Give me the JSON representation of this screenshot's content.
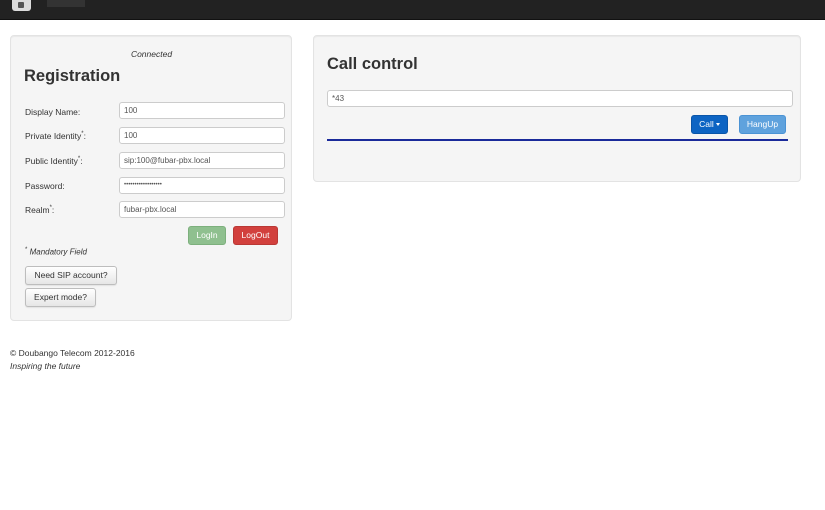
{
  "navbar": {
    "logo_icon": "doubango-logo-icon"
  },
  "registration": {
    "status": "Connected",
    "title": "Registration",
    "fields": [
      {
        "label": "Display Name:",
        "required": false,
        "value": "100"
      },
      {
        "label": "Private Identity",
        "required": true,
        "suffix": ":",
        "value": "100"
      },
      {
        "label": "Public Identity",
        "required": true,
        "suffix": ":",
        "value": "sip:100@fubar-pbx.local"
      },
      {
        "label": "Password:",
        "required": false,
        "value": "••••••••••••••••••"
      },
      {
        "label": "Realm",
        "required": true,
        "suffix": ":",
        "value": "fubar-pbx.local"
      }
    ],
    "login_label": "LogIn",
    "logout_label": "LogOut",
    "mandatory_mark": "*",
    "mandatory_text": "Mandatory Field",
    "need_sip_label": "Need SIP account?",
    "expert_mode_label": "Expert mode?"
  },
  "call_control": {
    "title": "Call control",
    "number_value": "*43",
    "call_label": "Call",
    "hangup_label": "HangUp"
  },
  "footer": {
    "copyright": "© Doubango Telecom 2012-2016",
    "tagline": "Inspiring the future"
  },
  "colors": {
    "navbar": "#222222",
    "login": "#8fc08f",
    "logout": "#d2403d",
    "call": "#0d64c3",
    "hangup": "#5fa2dd",
    "divider": "#1a2a9a"
  }
}
